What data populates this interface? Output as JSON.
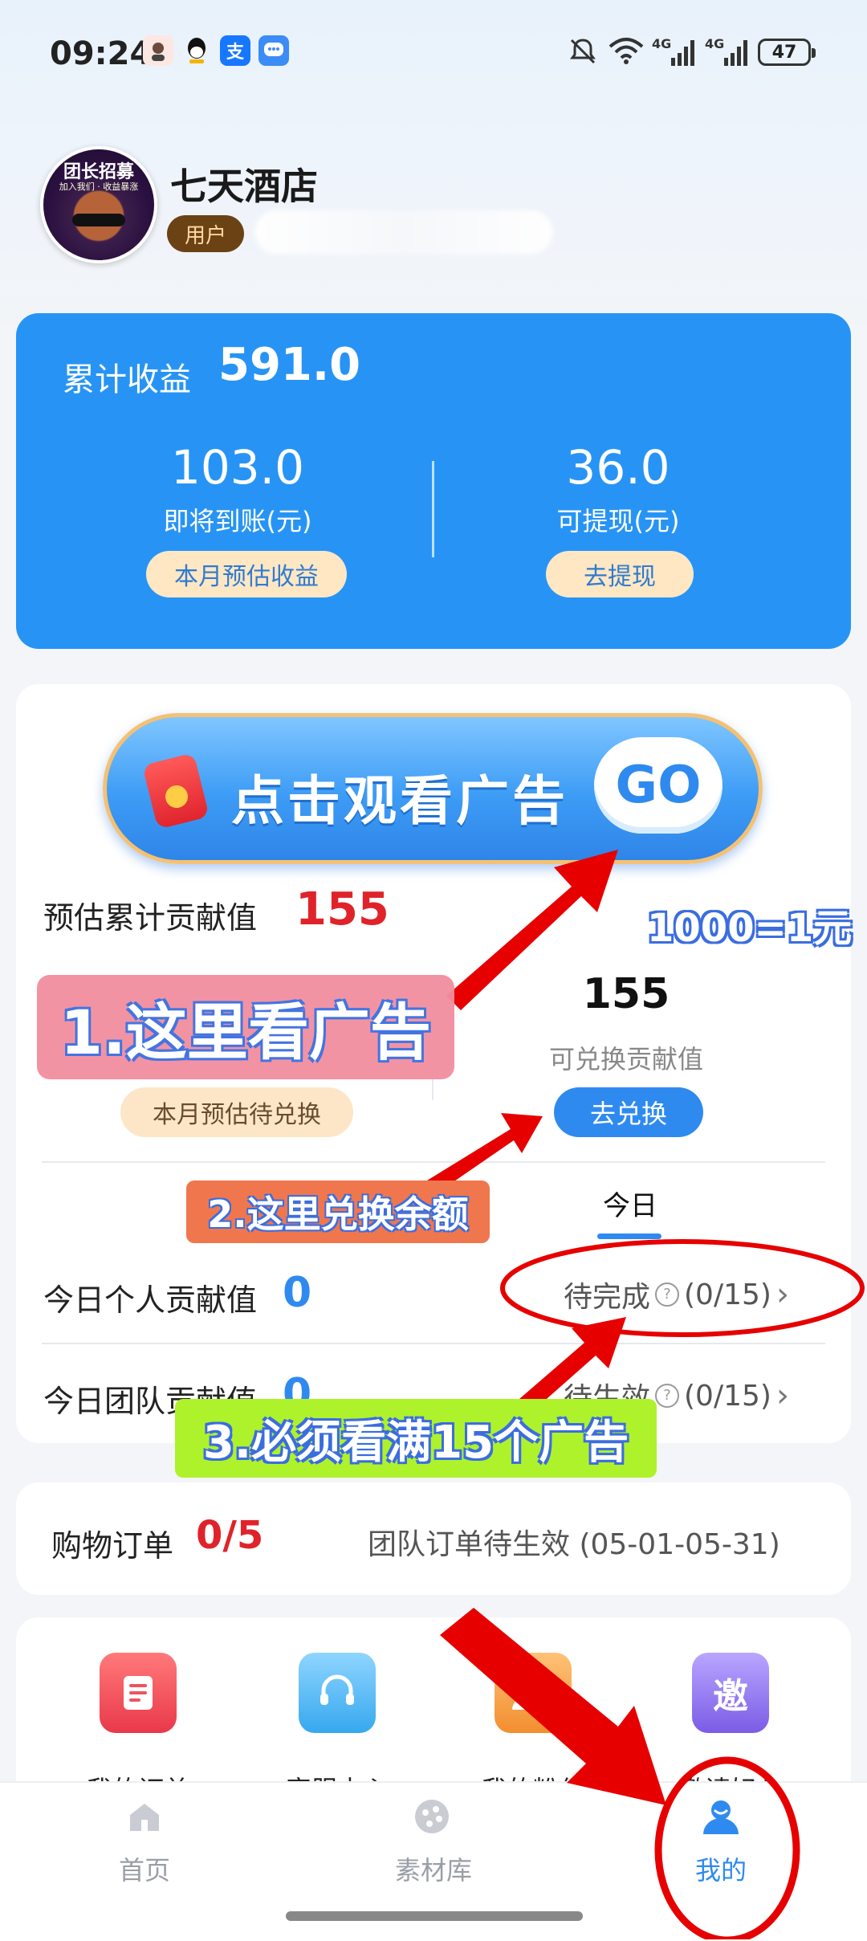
{
  "status_bar": {
    "time": "09:24",
    "notif_icons": [
      "avatar-icon",
      "qq-icon",
      "alipay-icon",
      "message-icon"
    ],
    "alipay_glyph": "支",
    "signal_labels": [
      "4G",
      "4G"
    ],
    "battery": "47"
  },
  "profile": {
    "avatar_text": "团长招募",
    "avatar_sub": "加入我们 · 收益暴涨",
    "name": "七天酒店",
    "role": "用户"
  },
  "earnings": {
    "total_label": "累计收益",
    "total_value": "591.0",
    "pending_value": "103.0",
    "pending_label": "即将到账(元)",
    "pending_button": "本月预估收益",
    "withdrawable_value": "36.0",
    "withdrawable_label": "可提现(元)",
    "withdraw_button": "去提现"
  },
  "contribution": {
    "ad_banner_text": "点击观看广告",
    "ad_go": "GO",
    "estimated_label": "预估累计贡献值",
    "estimated_value": "155",
    "exchangeable_value": "155",
    "exchangeable_label": "可兑换贡献值",
    "exchange_button": "去兑换",
    "monthly_button": "本月预估待兑换",
    "tab_today": "今日",
    "personal_label": "今日个人贡献值",
    "personal_value": "0",
    "personal_status": "待完成",
    "personal_progress": "(0/15)",
    "team_label": "今日团队贡献值",
    "team_value": "0",
    "team_status": "待生效",
    "team_progress": "(0/15)"
  },
  "orders": {
    "label": "购物订单",
    "count": "0/5",
    "status": "团队订单待生效 (05-01-05-31)"
  },
  "menu": {
    "items": [
      {
        "label": "我的订单",
        "icon": "order-list-icon",
        "color": "#f0545c"
      },
      {
        "label": "客服中心",
        "icon": "headset-icon",
        "color": "#41b4f2"
      },
      {
        "label": "我的粉丝",
        "icon": "fans-icon",
        "color": "#f7a13e"
      },
      {
        "label": "邀请好友",
        "icon": "invite-icon",
        "color": "#9277ea",
        "glyph": "邀"
      }
    ]
  },
  "nav": {
    "items": [
      {
        "label": "首页",
        "icon": "home-icon",
        "active": false
      },
      {
        "label": "素材库",
        "icon": "material-icon",
        "active": false
      },
      {
        "label": "我的",
        "icon": "profile-icon",
        "active": true
      }
    ]
  },
  "annotations": {
    "step1": "1.这里看广告",
    "step2": "2.这里兑换余额",
    "step3": "3.必须看满15个广告",
    "ratio": "1000=1元"
  },
  "colors": {
    "primary_blue": "#2f8af0",
    "card_blue": "#2794f5",
    "accent_red": "#e0232a",
    "annotation_red": "#e60000"
  }
}
